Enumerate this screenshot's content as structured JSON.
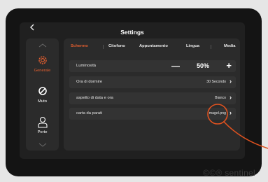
{
  "screen": {
    "back_icon": "chevron-left-icon",
    "title": "Settings"
  },
  "sidebar": {
    "up_chevron": "chevron-up-icon",
    "down_chevron": "chevron-down-icon",
    "items": [
      {
        "label": "Generale",
        "icon": "gear-icon",
        "active": true
      },
      {
        "label": "Muto",
        "icon": "mute-icon",
        "active": false
      },
      {
        "label": "Porte",
        "icon": "person-icon",
        "active": false
      }
    ]
  },
  "tabs": [
    {
      "label": "Schermo",
      "active": true
    },
    {
      "label": "Citofono",
      "active": false
    },
    {
      "label": "Appuntamento",
      "active": false
    },
    {
      "label": "Lingua",
      "active": false
    },
    {
      "label": "Media",
      "active": false
    }
  ],
  "rows": {
    "brightness": {
      "label": "Luminosità",
      "minus": "—",
      "value": "50%",
      "plus": "+"
    },
    "sleep": {
      "label": "Ora di dormire",
      "value": "30 Secondo"
    },
    "datetime": {
      "label": "aspetto di data e ora",
      "value": "Bianco"
    },
    "wallpaper": {
      "label": "carta da parati",
      "value": "magel.png"
    }
  },
  "row_chevron": "›",
  "watermark": "©©® sentinel",
  "colors": {
    "accent": "#e25e2f",
    "annotation": "#e0521f",
    "panel": "#2b2b2b",
    "row": "#333333"
  }
}
